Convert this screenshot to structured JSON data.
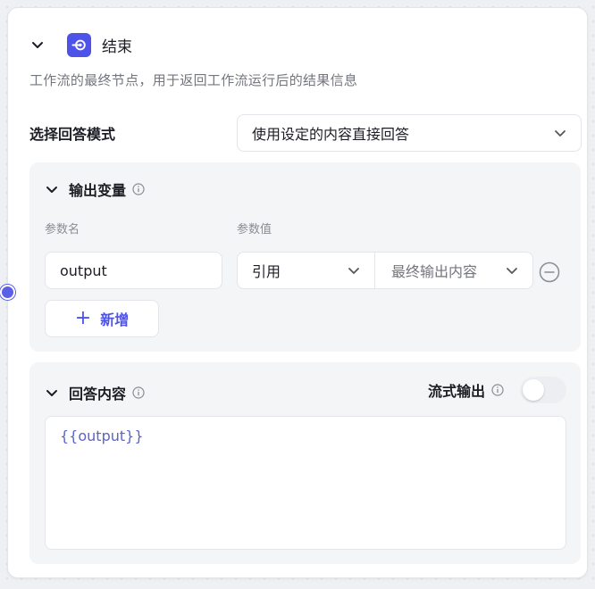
{
  "node": {
    "title": "结束",
    "description": "工作流的最终节点，用于返回工作流运行后的结果信息",
    "icon": "end-node-icon",
    "accent": "#4d53e8"
  },
  "answer_mode": {
    "label": "选择回答模式",
    "selected": "使用设定的内容直接回答"
  },
  "output_vars": {
    "title": "输出变量",
    "col_name": "参数名",
    "col_value": "参数值",
    "rows": [
      {
        "name": "output",
        "source_type": "引用",
        "value": "最终输出内容"
      }
    ],
    "add_label": "新增"
  },
  "answer_content": {
    "title": "回答内容",
    "stream_label": "流式输出",
    "stream_enabled": false,
    "content": "{{output}}"
  }
}
